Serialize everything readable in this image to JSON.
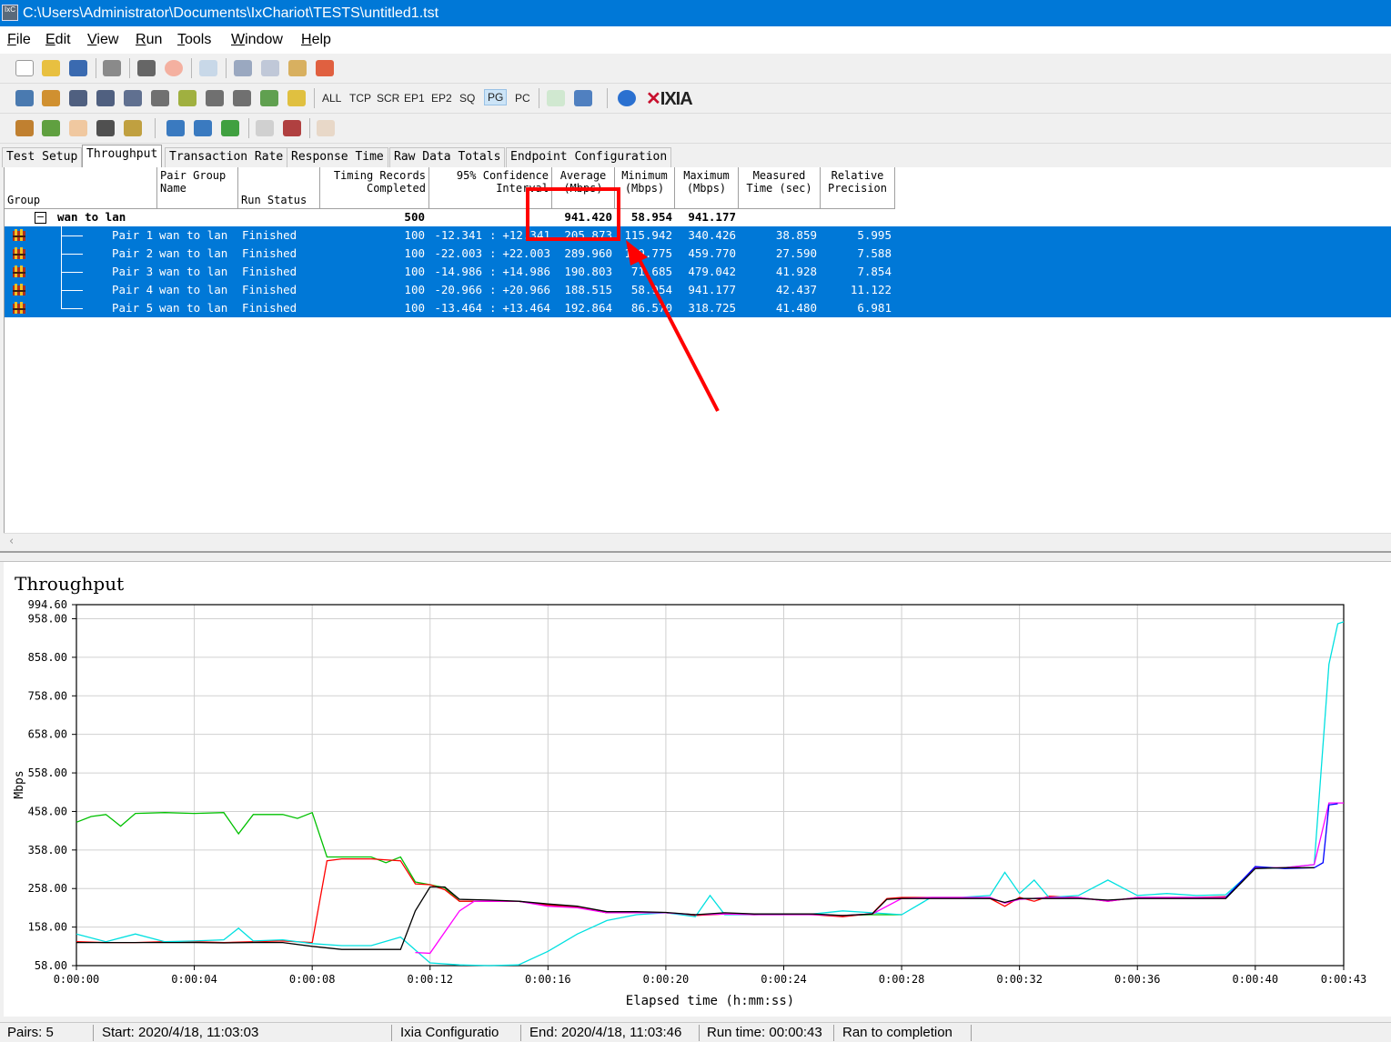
{
  "window": {
    "title": "C:\\Users\\Administrator\\Documents\\IxChariot\\TESTS\\untitled1.tst",
    "app_icon": "IxC"
  },
  "menu": [
    "File",
    "Edit",
    "View",
    "Run",
    "Tools",
    "Window",
    "Help"
  ],
  "toolbar2": {
    "filters": [
      "ALL",
      "TCP",
      "SCR",
      "EP1",
      "EP2",
      "SQ",
      "PG",
      "PC"
    ],
    "active_filter": "PG",
    "brand": "IXIA"
  },
  "tabs": [
    "Test Setup",
    "Throughput",
    "Transaction Rate",
    "Response Time",
    "Raw Data Totals",
    "Endpoint Configuration"
  ],
  "active_tab": "Throughput",
  "table": {
    "headers": {
      "group": "Group",
      "pair_group_name": [
        "Pair Group",
        "Name"
      ],
      "run_status": "Run Status",
      "timing_records": [
        "Timing Records",
        "Completed"
      ],
      "confidence": [
        "95% Confidence",
        "Interval"
      ],
      "average": [
        "Average",
        "(Mbps)"
      ],
      "minimum": [
        "Minimum",
        "(Mbps)"
      ],
      "maximum": [
        "Maximum",
        "(Mbps)"
      ],
      "measured_time": [
        "Measured",
        "Time (sec)"
      ],
      "relative_precision": [
        "Relative",
        "Precision"
      ]
    },
    "group_row": {
      "expander": "−",
      "name": "wan to lan",
      "records": "500",
      "average": "941.420",
      "minimum": "58.954",
      "maximum": "941.177"
    },
    "rows": [
      {
        "pair": "Pair 1",
        "group": "wan to lan",
        "status": "Finished",
        "records": "100",
        "ci_low": "-12.341",
        "ci_high": "+12.341",
        "average": "205.873",
        "minimum": "115.942",
        "maximum": "340.426",
        "time": "38.859",
        "precision": "5.995"
      },
      {
        "pair": "Pair 2",
        "group": "wan to lan",
        "status": "Finished",
        "records": "100",
        "ci_low": "-22.003",
        "ci_high": "+22.003",
        "average": "289.960",
        "minimum": "179.775",
        "maximum": "459.770",
        "time": "27.590",
        "precision": "7.588"
      },
      {
        "pair": "Pair 3",
        "group": "wan to lan",
        "status": "Finished",
        "records": "100",
        "ci_low": "-14.986",
        "ci_high": "+14.986",
        "average": "190.803",
        "minimum": "71.685",
        "maximum": "479.042",
        "time": "41.928",
        "precision": "7.854"
      },
      {
        "pair": "Pair 4",
        "group": "wan to lan",
        "status": "Finished",
        "records": "100",
        "ci_low": "-20.966",
        "ci_high": "+20.966",
        "average": "188.515",
        "minimum": "58.954",
        "maximum": "941.177",
        "time": "42.437",
        "precision": "11.122"
      },
      {
        "pair": "Pair 5",
        "group": "wan to lan",
        "status": "Finished",
        "records": "100",
        "ci_low": "-13.464",
        "ci_high": "+13.464",
        "average": "192.864",
        "minimum": "86.570",
        "maximum": "318.725",
        "time": "41.480",
        "precision": "6.981"
      }
    ],
    "ci_separator": ":"
  },
  "annotation_color": "#ff0000",
  "chart_data": {
    "type": "line",
    "title": "Throughput",
    "xlabel": "Elapsed time (h:mm:ss)",
    "ylabel": "Mbps",
    "xlim": [
      0,
      43
    ],
    "ylim": [
      58.0,
      994.6
    ],
    "x_ticks": [
      "0:00:00",
      "0:00:04",
      "0:00:08",
      "0:00:12",
      "0:00:16",
      "0:00:20",
      "0:00:24",
      "0:00:28",
      "0:00:32",
      "0:00:36",
      "0:00:40",
      "0:00:43"
    ],
    "x_tick_values": [
      0,
      4,
      8,
      12,
      16,
      20,
      24,
      28,
      32,
      36,
      40,
      43
    ],
    "y_ticks": [
      "58.00",
      "158.00",
      "258.00",
      "358.00",
      "458.00",
      "558.00",
      "658.00",
      "758.00",
      "858.00",
      "958.00",
      "994.60"
    ],
    "y_tick_values": [
      58,
      158,
      258,
      358,
      458,
      558,
      658,
      758,
      858,
      958,
      994.6
    ],
    "grid": true,
    "series": [
      {
        "color": "#00c000",
        "points": [
          [
            0,
            430
          ],
          [
            0.5,
            445
          ],
          [
            1,
            450
          ],
          [
            1.5,
            420
          ],
          [
            2,
            453
          ],
          [
            3,
            455
          ],
          [
            4,
            453
          ],
          [
            5,
            455
          ],
          [
            5.5,
            400
          ],
          [
            6,
            450
          ],
          [
            7,
            450
          ],
          [
            7.5,
            440
          ],
          [
            8,
            455
          ],
          [
            8.5,
            340
          ],
          [
            9,
            340
          ],
          [
            10,
            340
          ],
          [
            10.5,
            325
          ],
          [
            11,
            340
          ],
          [
            11.5,
            275
          ],
          [
            12,
            268
          ],
          [
            12.5,
            260
          ],
          [
            13,
            225
          ],
          [
            14,
            225
          ],
          [
            15,
            225
          ],
          [
            16,
            215
          ],
          [
            17,
            210
          ],
          [
            18,
            195
          ],
          [
            19,
            195
          ],
          [
            20,
            195
          ],
          [
            21,
            190
          ],
          [
            22,
            192
          ],
          [
            23,
            190
          ],
          [
            24,
            192
          ],
          [
            25,
            190
          ],
          [
            26,
            188
          ],
          [
            27,
            190
          ],
          [
            28,
            190
          ]
        ]
      },
      {
        "color": "#ff0000",
        "points": [
          [
            0,
            120
          ],
          [
            1,
            118
          ],
          [
            2,
            118
          ],
          [
            3,
            120
          ],
          [
            4,
            120
          ],
          [
            5,
            118
          ],
          [
            6,
            120
          ],
          [
            7,
            122
          ],
          [
            8,
            118
          ],
          [
            8.5,
            330
          ],
          [
            9,
            335
          ],
          [
            10,
            335
          ],
          [
            11,
            330
          ],
          [
            11.5,
            270
          ],
          [
            12,
            268
          ],
          [
            12.5,
            255
          ],
          [
            13,
            225
          ],
          [
            14,
            225
          ],
          [
            15,
            225
          ],
          [
            16,
            215
          ],
          [
            17,
            210
          ],
          [
            18,
            195
          ],
          [
            19,
            195
          ],
          [
            20,
            195
          ],
          [
            21,
            188
          ],
          [
            22,
            192
          ],
          [
            23,
            190
          ],
          [
            24,
            192
          ],
          [
            25,
            190
          ],
          [
            26,
            185
          ],
          [
            27,
            193
          ],
          [
            27.5,
            232
          ],
          [
            28,
            235
          ],
          [
            29,
            235
          ],
          [
            30,
            235
          ],
          [
            31,
            232
          ],
          [
            31.5,
            212
          ],
          [
            32,
            235
          ],
          [
            32.5,
            225
          ],
          [
            33,
            238
          ],
          [
            34,
            235
          ],
          [
            35,
            225
          ],
          [
            36,
            235
          ],
          [
            37,
            235
          ],
          [
            38,
            235
          ],
          [
            39,
            237
          ]
        ]
      },
      {
        "color": "#00e0e0",
        "points": [
          [
            0,
            140
          ],
          [
            1,
            120
          ],
          [
            2,
            140
          ],
          [
            3,
            120
          ],
          [
            4,
            122
          ],
          [
            5,
            125
          ],
          [
            5.5,
            155
          ],
          [
            6,
            122
          ],
          [
            7,
            125
          ],
          [
            8,
            115
          ],
          [
            9,
            110
          ],
          [
            10,
            110
          ],
          [
            11,
            132
          ],
          [
            12,
            65
          ],
          [
            13,
            60
          ],
          [
            14,
            58
          ],
          [
            15,
            60
          ],
          [
            16,
            95
          ],
          [
            17,
            140
          ],
          [
            18,
            175
          ],
          [
            19,
            190
          ],
          [
            20,
            195
          ],
          [
            21,
            185
          ],
          [
            21.5,
            240
          ],
          [
            22,
            190
          ],
          [
            23,
            190
          ],
          [
            24,
            190
          ],
          [
            25,
            192
          ],
          [
            26,
            200
          ],
          [
            27,
            195
          ],
          [
            28,
            190
          ],
          [
            29,
            235
          ],
          [
            30,
            235
          ],
          [
            31,
            240
          ],
          [
            31.5,
            300
          ],
          [
            32,
            245
          ],
          [
            32.5,
            280
          ],
          [
            33,
            235
          ],
          [
            34,
            240
          ],
          [
            35,
            280
          ],
          [
            36,
            240
          ],
          [
            37,
            245
          ],
          [
            38,
            240
          ],
          [
            39,
            242
          ],
          [
            40,
            310
          ],
          [
            41,
            312
          ],
          [
            42,
            320
          ],
          [
            42.5,
            840
          ],
          [
            42.8,
            945
          ],
          [
            43,
            950
          ]
        ]
      },
      {
        "color": "#ff00ff",
        "points": [
          [
            11.5,
            92
          ],
          [
            12,
            90
          ],
          [
            13,
            200
          ],
          [
            13.5,
            225
          ],
          [
            14,
            225
          ],
          [
            15,
            225
          ],
          [
            16,
            212
          ],
          [
            17,
            208
          ],
          [
            18,
            195
          ],
          [
            19,
            195
          ],
          [
            20,
            195
          ],
          [
            21,
            190
          ],
          [
            22,
            192
          ],
          [
            23,
            190
          ],
          [
            24,
            190
          ],
          [
            25,
            190
          ],
          [
            26,
            188
          ],
          [
            27,
            192
          ],
          [
            28,
            232
          ],
          [
            29,
            235
          ],
          [
            30,
            235
          ],
          [
            31,
            235
          ],
          [
            31.5,
            220
          ],
          [
            32,
            230
          ],
          [
            33,
            235
          ],
          [
            34,
            235
          ],
          [
            35,
            225
          ],
          [
            36,
            235
          ],
          [
            37,
            235
          ],
          [
            38,
            235
          ],
          [
            39,
            235
          ],
          [
            40,
            312
          ],
          [
            41,
            312
          ],
          [
            42,
            320
          ],
          [
            42.5,
            480
          ],
          [
            43,
            480
          ]
        ]
      },
      {
        "color": "#0000ff",
        "points": [
          [
            39,
            235
          ],
          [
            40,
            315
          ],
          [
            41,
            310
          ],
          [
            42,
            312
          ],
          [
            42.3,
            325
          ],
          [
            42.5,
            475
          ],
          [
            42.8,
            478
          ]
        ]
      },
      {
        "color": "#000000",
        "points": [
          [
            0,
            118
          ],
          [
            1,
            118
          ],
          [
            2,
            118
          ],
          [
            3,
            118
          ],
          [
            4,
            118
          ],
          [
            5,
            117
          ],
          [
            6,
            118
          ],
          [
            7,
            118
          ],
          [
            8,
            108
          ],
          [
            9,
            100
          ],
          [
            10,
            100
          ],
          [
            11,
            100
          ],
          [
            11.5,
            200
          ],
          [
            12,
            262
          ],
          [
            12.5,
            262
          ],
          [
            13,
            230
          ],
          [
            14,
            228
          ],
          [
            15,
            225
          ],
          [
            16,
            218
          ],
          [
            17,
            212
          ],
          [
            18,
            198
          ],
          [
            19,
            198
          ],
          [
            20,
            196
          ],
          [
            21,
            190
          ],
          [
            22,
            195
          ],
          [
            23,
            192
          ],
          [
            24,
            192
          ],
          [
            25,
            192
          ],
          [
            26,
            188
          ],
          [
            27,
            192
          ],
          [
            27.5,
            230
          ],
          [
            28,
            232
          ],
          [
            29,
            232
          ],
          [
            30,
            232
          ],
          [
            31,
            232
          ],
          [
            31.5,
            222
          ],
          [
            32,
            232
          ],
          [
            33,
            232
          ],
          [
            34,
            232
          ],
          [
            35,
            228
          ],
          [
            36,
            232
          ],
          [
            37,
            232
          ],
          [
            38,
            232
          ],
          [
            39,
            232
          ],
          [
            40,
            310
          ],
          [
            41,
            312
          ],
          [
            42,
            312
          ]
        ]
      }
    ]
  },
  "status": {
    "pairs": "Pairs: 5",
    "start": "Start: 2020/4/18, 11:03:03",
    "config": "Ixia Configuratio",
    "end": "End: 2020/4/18, 11:03:46",
    "runtime": "Run time: 00:00:43",
    "completion": "Ran to completion"
  }
}
